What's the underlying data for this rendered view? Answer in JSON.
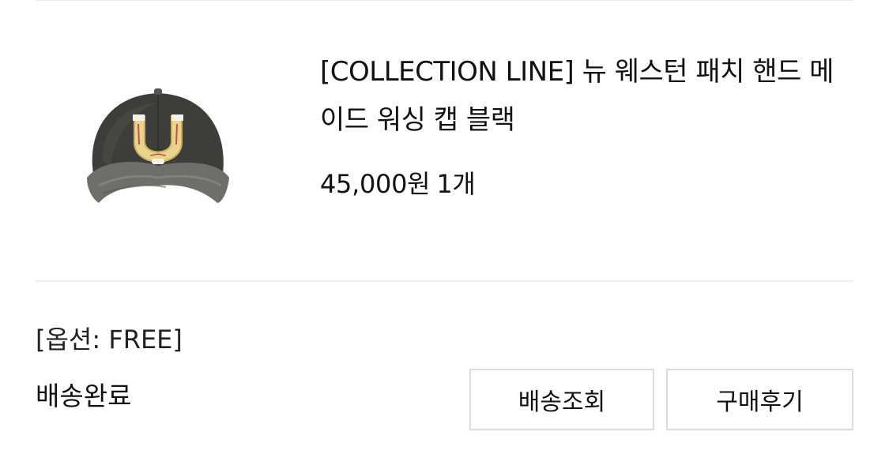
{
  "order_item": {
    "product_name": "[COLLECTION LINE] 뉴 웨스턴 패치 핸드 메이드 워싱 캡 블랙",
    "price": "45,000원",
    "quantity": "1개",
    "image_icon": "black-washed-cap-with-horseshoe-patch",
    "option": "[옵션: FREE]",
    "status": "배송완료"
  },
  "actions": {
    "track_label": "배송조회",
    "review_label": "구매후기"
  }
}
